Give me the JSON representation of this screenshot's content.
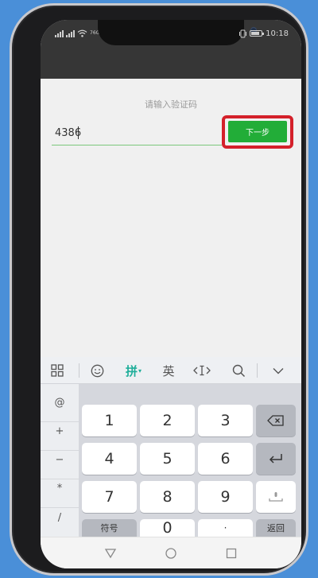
{
  "status": {
    "network_label": "76G",
    "time": "10:18"
  },
  "page": {
    "prompt": "请输入验证码",
    "code_value": "4386",
    "next_button": "下一步"
  },
  "keyboard": {
    "toolbar": {
      "menu_icon": "grid-icon",
      "emoji_icon": "emoji-icon",
      "pinyin": "拼",
      "english": "英",
      "cursor_icon": "cursor-move-icon",
      "search_icon": "search-icon",
      "collapse_icon": "chevron-down-icon"
    },
    "symbols": [
      "@",
      "+",
      "−",
      "*",
      "/"
    ],
    "digits": [
      "1",
      "2",
      "3",
      "4",
      "5",
      "6",
      "7",
      "8",
      "9",
      "0"
    ],
    "symbols_key": "符号",
    "dot_key": "·",
    "return_key": "返回",
    "backspace_icon": "backspace-icon",
    "enter_icon": "enter-icon",
    "space_icon": "space-icon"
  },
  "colors": {
    "accent_green": "#22ad38",
    "highlight_red": "#d4202a",
    "pinyin_teal": "#1fae9a"
  }
}
